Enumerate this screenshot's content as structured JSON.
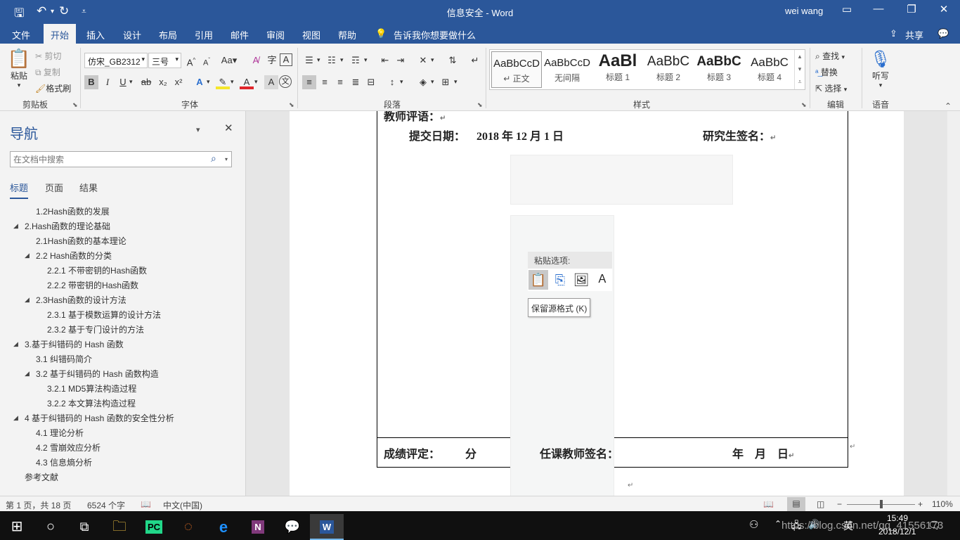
{
  "title_bar": {
    "doc_title": "信息安全  -  Word",
    "user": "wei wang"
  },
  "tabs": [
    "文件",
    "开始",
    "插入",
    "设计",
    "布局",
    "引用",
    "邮件",
    "审阅",
    "视图",
    "帮助"
  ],
  "active_tab": "开始",
  "tell_me": "告诉我你想要做什么",
  "share": "共享",
  "clipboard": {
    "paste": "粘贴",
    "cut": "剪切",
    "copy": "复制",
    "format_painter": "格式刷",
    "label": "剪贴板"
  },
  "font": {
    "name": "仿宋_GB2312",
    "size": "三号",
    "label": "字体",
    "aa": "Aa",
    "bold": "B",
    "italic": "I",
    "underline": "U",
    "strike": "ab",
    "subscript": "x₂",
    "superscript": "x²",
    "a_upper": "A",
    "char_border": "A",
    "phonetic": "文",
    "phonetic_guide": "字"
  },
  "paragraph": {
    "label": "段落"
  },
  "styles": {
    "label": "样式",
    "items": [
      {
        "preview": "AaBbCcD",
        "name": "↵ 正文"
      },
      {
        "preview": "AaBbCcD",
        "name": "无间隔"
      },
      {
        "preview": "AaBl",
        "name": "标题 1"
      },
      {
        "preview": "AaBbC",
        "name": "标题 2"
      },
      {
        "preview": "AaBbC",
        "name": "标题 3"
      },
      {
        "preview": "AaBbC",
        "name": "标题 4"
      }
    ]
  },
  "editing": {
    "find": "查找",
    "replace": "替换",
    "select": "选择",
    "label": "编辑"
  },
  "voice": {
    "dictate": "听写",
    "label": "语音"
  },
  "nav": {
    "title": "导航",
    "search_placeholder": "在文档中搜索",
    "tabs": [
      "标题",
      "页面",
      "结果"
    ],
    "headings": [
      {
        "text": "1.2Hash函数的发展",
        "level": 2,
        "expanded": null
      },
      {
        "text": "2.Hash函数的理论基础",
        "level": 1,
        "expanded": true
      },
      {
        "text": "2.1Hash函数的基本理论",
        "level": 2,
        "expanded": null
      },
      {
        "text": "2.2 Hash函数的分类",
        "level": 2,
        "expanded": true
      },
      {
        "text": "2.2.1 不带密钥的Hash函数",
        "level": 3,
        "expanded": null
      },
      {
        "text": "2.2.2 带密钥的Hash函数",
        "level": 3,
        "expanded": null
      },
      {
        "text": "2.3Hash函数的设计方法",
        "level": 2,
        "expanded": true
      },
      {
        "text": "2.3.1 基于模数运算的设计方法",
        "level": 3,
        "expanded": null
      },
      {
        "text": "2.3.2 基于专门设计的方法",
        "level": 3,
        "expanded": null
      },
      {
        "text": "3.基于纠错码的 Hash 函数",
        "level": 1,
        "expanded": true
      },
      {
        "text": "3.1 纠错码简介",
        "level": 2,
        "expanded": null
      },
      {
        "text": "3.2 基于纠错码的 Hash 函数构造",
        "level": 2,
        "expanded": true
      },
      {
        "text": "3.2.1 MD5算法构造过程",
        "level": 3,
        "expanded": null
      },
      {
        "text": "3.2.2 本文算法构造过程",
        "level": 3,
        "expanded": null
      },
      {
        "text": "4 基于纠错码的 Hash 函数的安全性分析",
        "level": 1,
        "expanded": true
      },
      {
        "text": "4.1 理论分析",
        "level": 2,
        "expanded": null
      },
      {
        "text": "4.2 雪崩效应分析",
        "level": 2,
        "expanded": null
      },
      {
        "text": "4.3 信息熵分析",
        "level": 2,
        "expanded": null
      },
      {
        "text": "参考文献",
        "level": 1,
        "expanded": null
      }
    ]
  },
  "document": {
    "teacher_comment": "教师评语：",
    "submit_date_label": "提交日期：",
    "submit_date_value": "2018 年 12 月 1 日",
    "student_sign": "研究生签名：",
    "grade_label": "成绩评定：",
    "grade_unit": "分",
    "teacher_sign": "任课教师签名：",
    "date_blank": "年    月    日"
  },
  "paste_menu": {
    "header": "粘贴选项:",
    "tooltip": "保留源格式 (K)"
  },
  "status": {
    "page": "第 1 页，共 18 页",
    "words": "6524 个字",
    "lang": "中文(中国)",
    "zoom": "110%"
  },
  "taskbar": {
    "ime": "英",
    "time": "15:49",
    "date": "2018/12/1",
    "watermark": "https://blog.csdn.net/qq_41556173"
  }
}
